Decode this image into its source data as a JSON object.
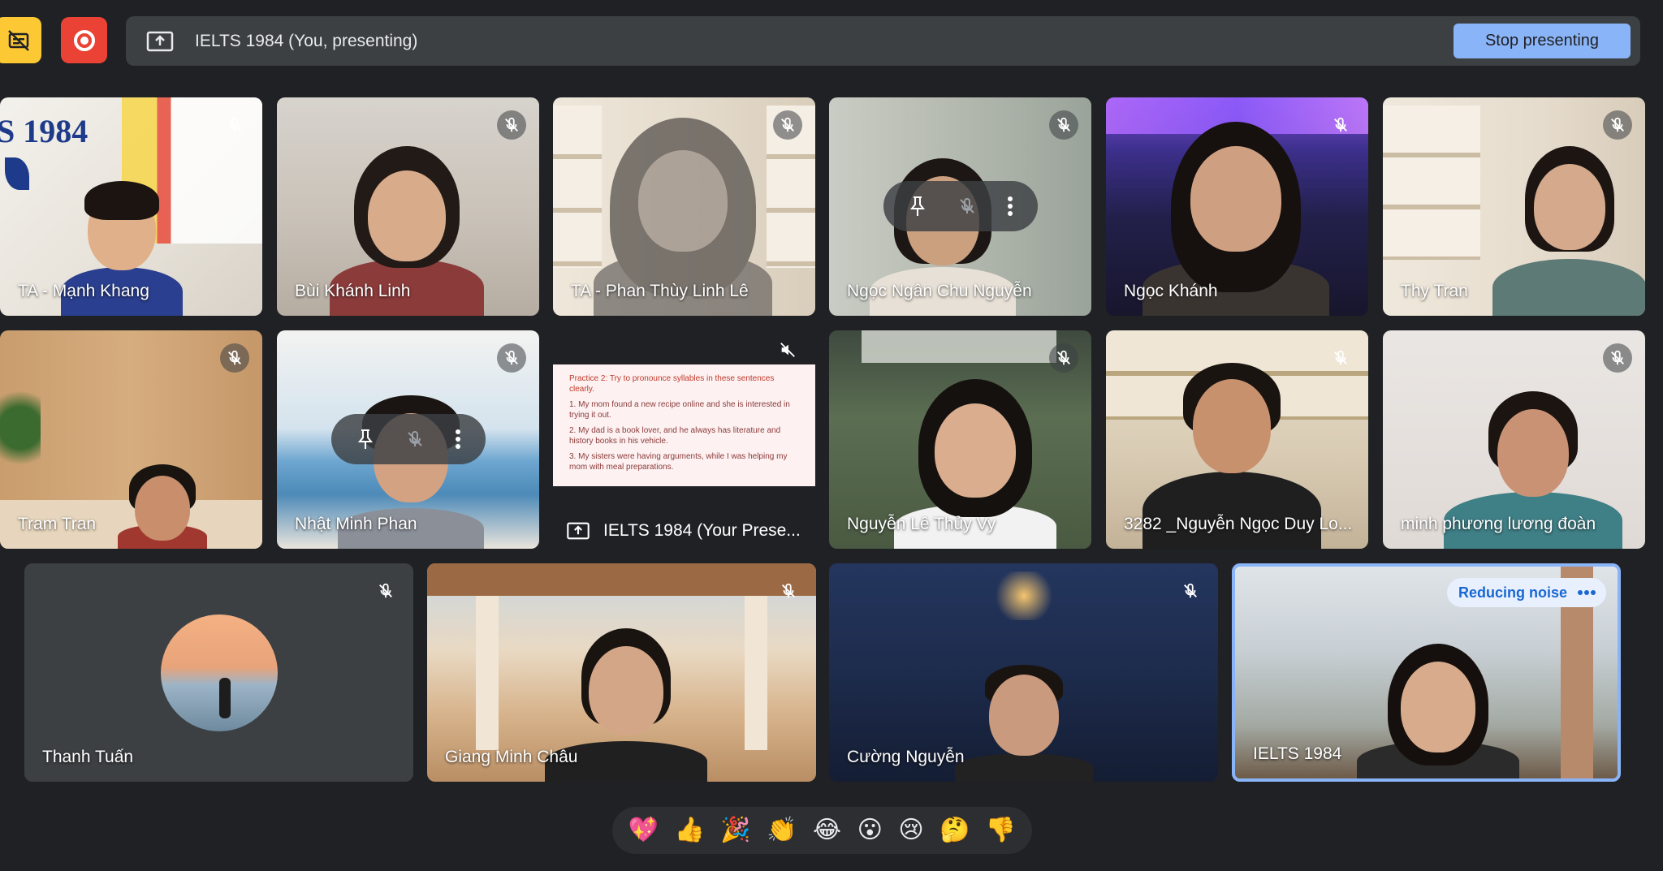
{
  "presenting": {
    "banner_text": "IELTS 1984 (You, presenting)",
    "stop_label": "Stop presenting"
  },
  "tiles": [
    {
      "name": "TA - Mạnh Khang",
      "muted": true
    },
    {
      "name": "Bùi Khánh Linh",
      "muted": true
    },
    {
      "name": "TA - Phan Thùy Linh Lê",
      "muted": true
    },
    {
      "name": "Ngọc Ngân Chu Nguyễn",
      "muted": true
    },
    {
      "name": "Ngọc Khánh",
      "muted": true
    },
    {
      "name": "Thy Tran",
      "muted": true
    },
    {
      "name": "Tram Tran",
      "muted": true
    },
    {
      "name": "Nhật Minh Phan",
      "muted": true
    },
    {
      "name": "IELTS 1984 (Your Prese...",
      "muted": true
    },
    {
      "name": "Nguyễn Lê Thủy Vy",
      "muted": true
    },
    {
      "name": "3282 _Nguyễn Ngọc Duy Lo...",
      "muted": true
    },
    {
      "name": "minh phương lương đoàn",
      "muted": true
    },
    {
      "name": "Thanh Tuấn",
      "muted": true
    },
    {
      "name": "Giang Minh Châu",
      "muted": true
    },
    {
      "name": "Cường Nguyễn",
      "muted": true
    },
    {
      "name": "IELTS 1984",
      "muted": false
    }
  ],
  "logo_text": "S 1984",
  "slide": {
    "heading": "Practice 2: Try to pronounce syllables in these sentences clearly.",
    "lines": [
      "1. My mom found a new recipe online and she is interested in trying it out.",
      "2. My dad is a book lover, and he always has literature and history books in his vehicle.",
      "3. My sisters were having arguments, while I was helping my mom with meal preparations."
    ]
  },
  "noise_label": "Reducing noise",
  "reactions": [
    "💖",
    "👍",
    "🎉",
    "👏",
    "😂",
    "😮",
    "😢",
    "🤔",
    "👎"
  ]
}
